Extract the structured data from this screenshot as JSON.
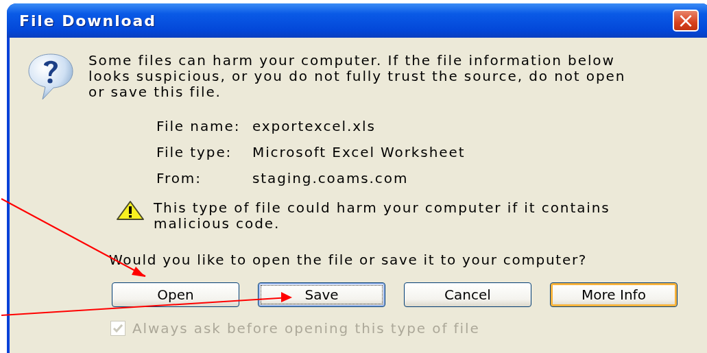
{
  "window": {
    "title": "File Download",
    "close": "×"
  },
  "message": "Some files can harm your computer. If the file information below looks suspicious, or you do not fully trust the source, do not open or save this file.",
  "details": [
    {
      "label": "File name:",
      "value": "exportexcel.xls"
    },
    {
      "label": "File type:",
      "value": "Microsoft Excel Worksheet"
    },
    {
      "label": "From:",
      "value": "staging.coams.com"
    }
  ],
  "warning": "This type of file could harm your computer if it contains malicious code.",
  "question": "Would you like to open the file or save it to your computer?",
  "buttons": [
    {
      "label": "Open",
      "focused": false,
      "highlighted": false
    },
    {
      "label": "Save",
      "focused": true,
      "highlighted": false
    },
    {
      "label": "Cancel",
      "focused": false,
      "highlighted": false
    },
    {
      "label": "More Info",
      "focused": false,
      "highlighted": true
    }
  ],
  "checkbox": {
    "label": "Always ask before opening this type of file",
    "checked": true,
    "disabled": true
  }
}
